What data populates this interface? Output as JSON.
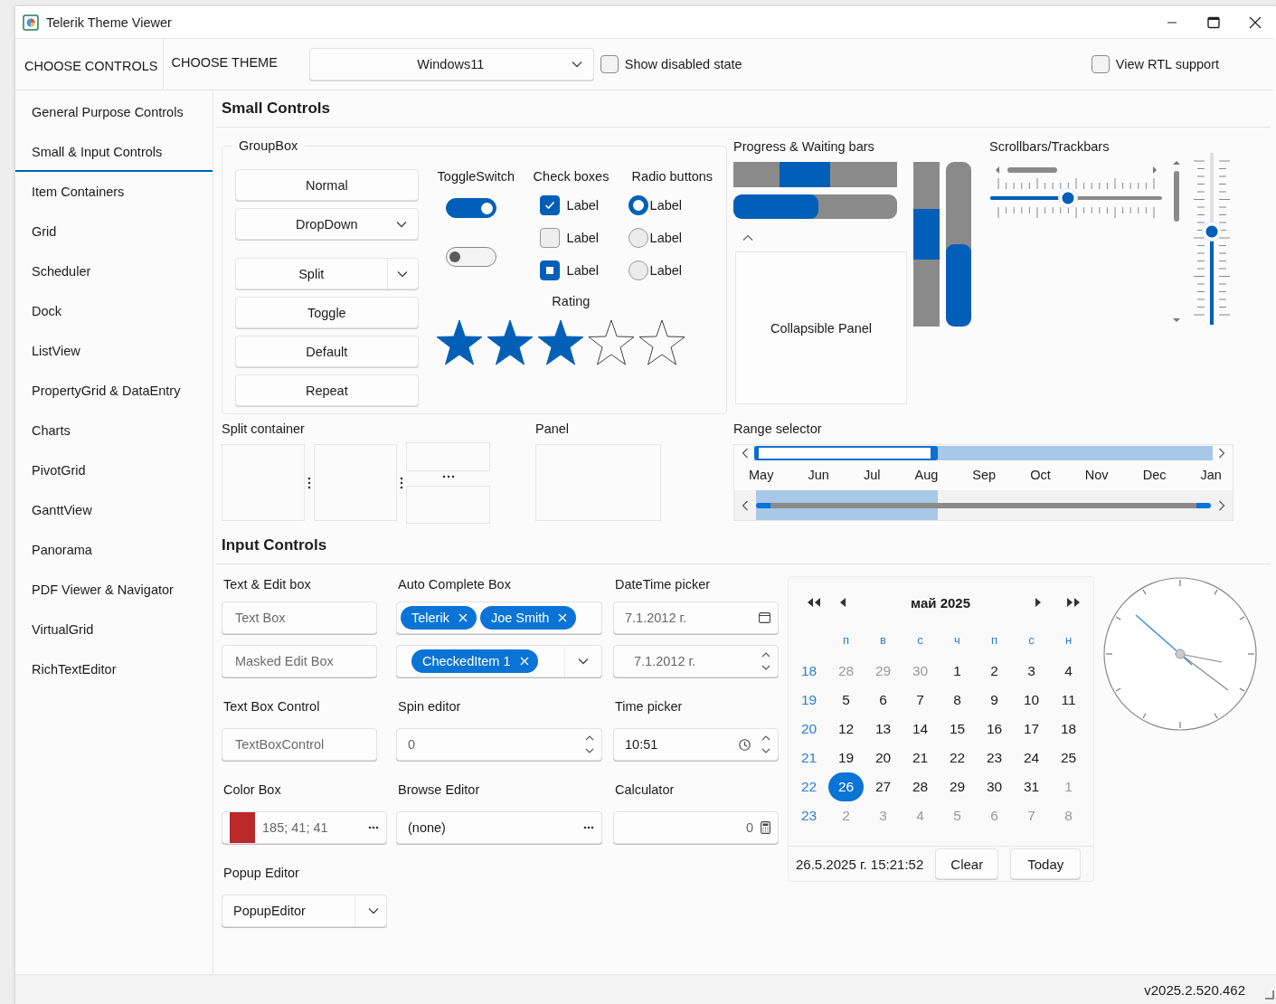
{
  "window": {
    "title": "Telerik Theme Viewer"
  },
  "toolbar": {
    "tabs": [
      {
        "label": "CHOOSE CONTROLS",
        "selected": true
      },
      {
        "label": "CHOOSE THEME",
        "selected": false
      }
    ],
    "theme_dropdown": {
      "value": "Windows11"
    },
    "show_disabled": {
      "label": "Show disabled state",
      "checked": false
    },
    "rtl_support": {
      "label": "View RTL support",
      "checked": false
    }
  },
  "sidebar": {
    "items": [
      {
        "label": "General Purpose Controls",
        "selected": false
      },
      {
        "label": "Small & Input Controls",
        "selected": true
      },
      {
        "label": "Item Containers",
        "selected": false
      },
      {
        "label": "Grid",
        "selected": false
      },
      {
        "label": "Scheduler",
        "selected": false
      },
      {
        "label": "Dock",
        "selected": false
      },
      {
        "label": "ListView",
        "selected": false
      },
      {
        "label": "PropertyGrid & DataEntry",
        "selected": false
      },
      {
        "label": "Charts",
        "selected": false
      },
      {
        "label": "PivotGrid",
        "selected": false
      },
      {
        "label": "GanttView",
        "selected": false
      },
      {
        "label": "Panorama",
        "selected": false
      },
      {
        "label": "PDF Viewer & Navigator",
        "selected": false
      },
      {
        "label": "VirtualGrid",
        "selected": false
      },
      {
        "label": "RichTextEditor",
        "selected": false
      }
    ]
  },
  "small_controls": {
    "title": "Small Controls",
    "groupbox": {
      "title": "GroupBox",
      "buttons": [
        {
          "kind": "push",
          "label": "Normal"
        },
        {
          "kind": "dropdown",
          "label": "DropDown"
        },
        {
          "kind": "split",
          "label": "Split"
        },
        {
          "kind": "push",
          "label": "Toggle"
        },
        {
          "kind": "push",
          "label": "Default"
        },
        {
          "kind": "push",
          "label": "Repeat"
        }
      ]
    },
    "toggle_switch": {
      "title": "ToggleSwitch",
      "switches": [
        {
          "on": true
        },
        {
          "on": false
        }
      ]
    },
    "check_boxes": {
      "title": "Check boxes",
      "items": [
        {
          "label": "Label",
          "checked": true,
          "indeterminate": false
        },
        {
          "label": "Label",
          "checked": false,
          "indeterminate": false
        },
        {
          "label": "Label",
          "checked": false,
          "indeterminate": true
        }
      ]
    },
    "radio_buttons": {
      "title": "Radio buttons",
      "items": [
        {
          "label": "Label",
          "selected": true
        },
        {
          "label": "Label",
          "selected": false
        },
        {
          "label": "Label",
          "selected": false
        }
      ]
    },
    "rating": {
      "title": "Rating",
      "stars": 3
    },
    "progress": {
      "title": "Progress & Waiting bars",
      "horizontal_bars": [
        {
          "kind": "waiting"
        },
        {
          "kind": "progress",
          "level": 0.52
        }
      ],
      "vertical_bars": [
        {
          "kind": "waiting"
        },
        {
          "kind": "progress",
          "level": 0.5
        }
      ]
    },
    "collapsible_panel": {
      "label": "Collapsible Panel",
      "expanded": true
    },
    "scrollbars": {
      "title": "Scrollbars/Trackbars",
      "horizontal_trackbar": {
        "level": 0.45
      },
      "vertical_trackbar": {
        "level": 0.54
      }
    },
    "split_container": {
      "title": "Split container"
    },
    "panel": {
      "title": "Panel"
    },
    "range_selector": {
      "title": "Range selector",
      "months": [
        "May",
        "Jun",
        "Jul",
        "Aug",
        "Sep",
        "Oct",
        "Nov",
        "Dec",
        "Jan"
      ],
      "selection": {
        "level": 0.4
      }
    }
  },
  "input_controls": {
    "title": "Input Controls",
    "text_edit": {
      "title": "Text & Edit box",
      "text_box": {
        "placeholder": "Text Box"
      },
      "masked_box": {
        "placeholder": "Masked Edit Box"
      }
    },
    "auto_complete": {
      "title": "Auto Complete Box",
      "tokens": [
        "Telerik",
        "Joe Smith"
      ],
      "checked_tokens": [
        "CheckedItem 1"
      ]
    },
    "datetime_picker": {
      "title": "DateTime picker",
      "values": [
        "7.1.2012 г.",
        "7.1.2012 г."
      ]
    },
    "text_box_control": {
      "title": "Text Box Control",
      "placeholder": "TextBoxControl"
    },
    "spin_editor": {
      "title": "Spin editor",
      "value": "0"
    },
    "time_picker": {
      "title": "Time picker",
      "value": "10:51"
    },
    "color_box": {
      "title": "Color Box",
      "color": "#b92929",
      "value": "185; 41; 41"
    },
    "browse_editor": {
      "title": "Browse Editor",
      "value": "(none)"
    },
    "calculator": {
      "title": "Calculator",
      "value": "0"
    },
    "popup_editor": {
      "title": "Popup Editor",
      "value": "PopupEditor"
    }
  },
  "calendar": {
    "title": "май 2025",
    "weekdays": [
      "п",
      "в",
      "с",
      "ч",
      "п",
      "с",
      "н"
    ],
    "weeks": [
      {
        "number": "18",
        "days": [
          {
            "label": "28",
            "other_month": true,
            "selected": false
          },
          {
            "label": "29",
            "other_month": true,
            "selected": false
          },
          {
            "label": "30",
            "other_month": true,
            "selected": false
          },
          {
            "label": "1",
            "other_month": false,
            "selected": false
          },
          {
            "label": "2",
            "other_month": false,
            "selected": false
          },
          {
            "label": "3",
            "other_month": false,
            "selected": false
          },
          {
            "label": "4",
            "other_month": false,
            "selected": false
          }
        ]
      },
      {
        "number": "19",
        "days": [
          {
            "label": "5",
            "other_month": false,
            "selected": false
          },
          {
            "label": "6",
            "other_month": false,
            "selected": false
          },
          {
            "label": "7",
            "other_month": false,
            "selected": false
          },
          {
            "label": "8",
            "other_month": false,
            "selected": false
          },
          {
            "label": "9",
            "other_month": false,
            "selected": false
          },
          {
            "label": "10",
            "other_month": false,
            "selected": false
          },
          {
            "label": "11",
            "other_month": false,
            "selected": false
          }
        ]
      },
      {
        "number": "20",
        "days": [
          {
            "label": "12",
            "other_month": false,
            "selected": false
          },
          {
            "label": "13",
            "other_month": false,
            "selected": false
          },
          {
            "label": "14",
            "other_month": false,
            "selected": false
          },
          {
            "label": "15",
            "other_month": false,
            "selected": false
          },
          {
            "label": "16",
            "other_month": false,
            "selected": false
          },
          {
            "label": "17",
            "other_month": false,
            "selected": false
          },
          {
            "label": "18",
            "other_month": false,
            "selected": false
          }
        ]
      },
      {
        "number": "21",
        "days": [
          {
            "label": "19",
            "other_month": false,
            "selected": false
          },
          {
            "label": "20",
            "other_month": false,
            "selected": false
          },
          {
            "label": "21",
            "other_month": false,
            "selected": false
          },
          {
            "label": "22",
            "other_month": false,
            "selected": false
          },
          {
            "label": "23",
            "other_month": false,
            "selected": false
          },
          {
            "label": "24",
            "other_month": false,
            "selected": false
          },
          {
            "label": "25",
            "other_month": false,
            "selected": false
          }
        ]
      },
      {
        "number": "22",
        "days": [
          {
            "label": "26",
            "other_month": false,
            "selected": true
          },
          {
            "label": "27",
            "other_month": false,
            "selected": false
          },
          {
            "label": "28",
            "other_month": false,
            "selected": false
          },
          {
            "label": "29",
            "other_month": false,
            "selected": false
          },
          {
            "label": "30",
            "other_month": false,
            "selected": false
          },
          {
            "label": "31",
            "other_month": false,
            "selected": false
          },
          {
            "label": "1",
            "other_month": true,
            "selected": false
          }
        ]
      },
      {
        "number": "23",
        "days": [
          {
            "label": "2",
            "other_month": true,
            "selected": false
          },
          {
            "label": "3",
            "other_month": true,
            "selected": false
          },
          {
            "label": "4",
            "other_month": true,
            "selected": false
          },
          {
            "label": "5",
            "other_month": true,
            "selected": false
          },
          {
            "label": "6",
            "other_month": true,
            "selected": false
          },
          {
            "label": "7",
            "other_month": true,
            "selected": false
          },
          {
            "label": "8",
            "other_month": true,
            "selected": false
          }
        ]
      }
    ],
    "footer_text": "26.5.2025 г. 15:21:52",
    "buttons": [
      "Clear",
      "Today"
    ]
  },
  "status_bar": {
    "version": "v2025.2.520.462"
  }
}
